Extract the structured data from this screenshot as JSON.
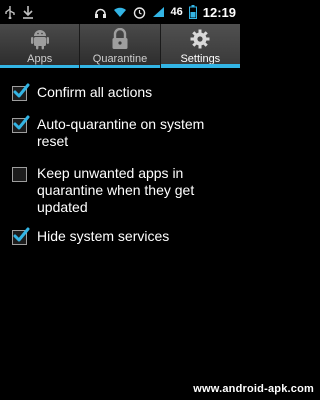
{
  "status_bar": {
    "icons": [
      "usb-icon",
      "download-icon",
      "headphones-icon",
      "wifi-icon",
      "alarm-icon",
      "signal-icon",
      "battery-icon"
    ],
    "battery": "46",
    "time": "12:19"
  },
  "tabs": [
    {
      "label": "Apps",
      "icon": "android-icon",
      "selected": false
    },
    {
      "label": "Quarantine",
      "icon": "lock-icon",
      "selected": false
    },
    {
      "label": "Settings",
      "icon": "gear-icon",
      "selected": true
    }
  ],
  "settings": [
    {
      "label": "Confirm all actions",
      "checked": true
    },
    {
      "label": "Auto-quarantine on system reset",
      "checked": true
    },
    {
      "label": "Keep unwanted apps in quarantine when they get updated",
      "checked": false
    },
    {
      "label": "Hide system services",
      "checked": true
    }
  ],
  "watermark": "www.android-apk.com",
  "colors": {
    "accent": "#33b5e5",
    "background": "#000000",
    "check": "#33b5e5"
  }
}
